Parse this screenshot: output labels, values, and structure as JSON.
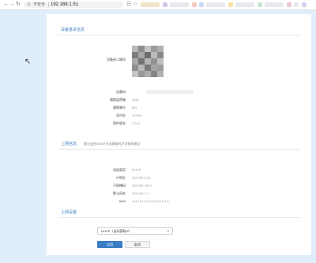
{
  "browser": {
    "security_label": "不安全",
    "url": "192.168.1.51"
  },
  "sections": {
    "device": {
      "title": "设备基本信息",
      "rows": [
        {
          "label": "设备码二维码",
          "value": ""
        },
        {
          "label": "设备码",
          "value": ""
        },
        {
          "label": "猫眼监视端",
          "value": "2581"
        },
        {
          "label": "猫眼端号",
          "value": "881"
        },
        {
          "label": "总内存",
          "value": "1024M"
        },
        {
          "label": "固件版本",
          "value": "1.0.11"
        }
      ]
    },
    "network": {
      "title": "上网信息",
      "note": "提示会在DHCP方式获取时才可修改地址",
      "rows": [
        {
          "label": "连接类型",
          "value": "DHCP"
        },
        {
          "label": "IP地址",
          "value": "192.168.1.51"
        },
        {
          "label": "子网掩码",
          "value": "255.255.255.0"
        },
        {
          "label": "默认网关",
          "value": "192.168.1.1"
        },
        {
          "label": "DNS",
          "value": "114.114.114.114 223.5.5.5"
        }
      ]
    },
    "settings": {
      "title": "上网设置",
      "select_value": "DHCP（自动获取IP）",
      "apply_label": "应用",
      "cancel_label": "取消"
    }
  }
}
